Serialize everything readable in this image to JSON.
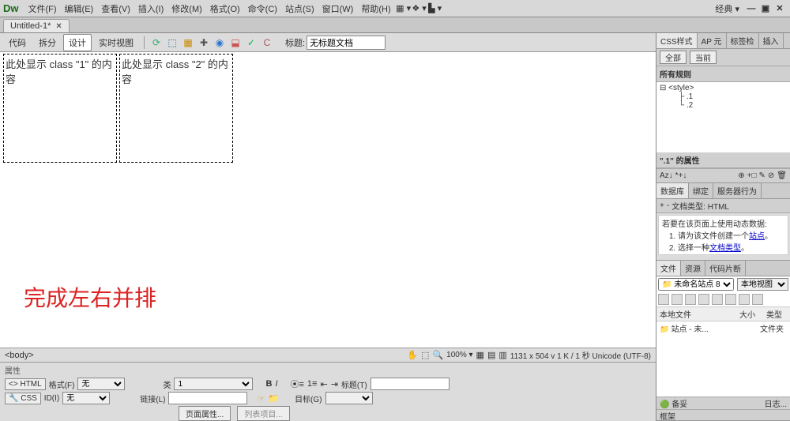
{
  "menus": [
    "文件(F)",
    "编辑(E)",
    "查看(V)",
    "插入(I)",
    "修改(M)",
    "格式(O)",
    "命令(C)",
    "站点(S)",
    "窗口(W)",
    "帮助(H)"
  ],
  "layout_label": "经典",
  "doc_tab": "Untitled-1*",
  "toolbar": {
    "btns": [
      "代码",
      "拆分",
      "设计",
      "实时视图"
    ],
    "active": 2,
    "title_label": "标题:",
    "title_value": "无标题文档"
  },
  "canvas": {
    "box1": "此处显示 class \"1\" 的内容",
    "box2": "此处显示 class \"2\" 的内容",
    "annotation": "完成左右并排"
  },
  "tagbar": {
    "path": "<body>",
    "zoom": "100%",
    "dims": "1131 x 504 v 1 K / 1 秒 Unicode (UTF-8)"
  },
  "props": {
    "title": "属性",
    "html_tab": "HTML",
    "css_tab": "CSS",
    "format_label": "格式(F)",
    "format_val": "无",
    "class_label": "类",
    "class_val": "1",
    "id_label": "ID(I)",
    "id_val": "无",
    "link_label": "链接(L)",
    "title_label2": "标题(T)",
    "target_label": "目标(G)",
    "pageprops": "页面属性...",
    "listitems": "列表项目..."
  },
  "css_panel": {
    "tabs": [
      "CSS样式",
      "AP 元",
      "标签检",
      "插入"
    ],
    "subtabs": [
      "全部",
      "当前"
    ],
    "rules_hdr": "所有规则",
    "tree": [
      "<style>",
      ".1",
      ".2"
    ],
    "prop_hdr": "\".1\" 的属性"
  },
  "db_panel": {
    "tabs": [
      "数据库",
      "绑定",
      "服务器行为"
    ],
    "doctype": "文档类型: HTML",
    "prompt": "若要在该页面上使用动态数据:",
    "step1_pre": "请为该文件创建一个",
    "step1_link": "站点",
    "step1_post": "。",
    "step2_pre": "选择一种",
    "step2_link": "文档类型",
    "step2_post": "。"
  },
  "files_panel": {
    "tabs": [
      "文件",
      "资源",
      "代码片断"
    ],
    "site": "未命名站点 8",
    "view": "本地视图",
    "cols": [
      "本地文件",
      "大小",
      "类型"
    ],
    "row_name": "站点 - 未...",
    "row_type": "文件夹"
  },
  "status": {
    "left": "备妥",
    "right": "日志..."
  },
  "frames": "框架"
}
